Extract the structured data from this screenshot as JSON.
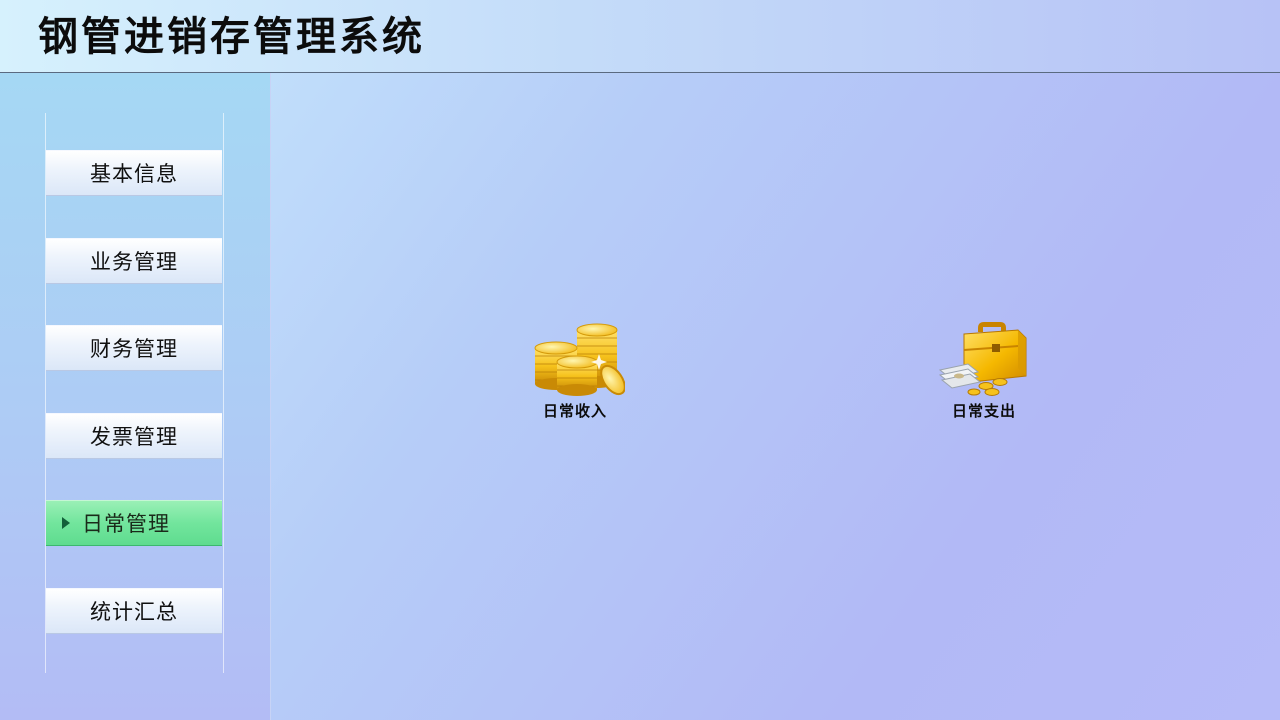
{
  "app": {
    "title": "钢管进销存管理系统"
  },
  "sidebar": {
    "items": [
      {
        "label": "基本信息"
      },
      {
        "label": "业务管理"
      },
      {
        "label": "财务管理"
      },
      {
        "label": "发票管理"
      },
      {
        "label": "日常管理",
        "selected": true
      },
      {
        "label": "统计汇总"
      }
    ]
  },
  "main": {
    "tiles": [
      {
        "label": "日常收入",
        "icon": "gold-coins-icon"
      },
      {
        "label": "日常支出",
        "icon": "briefcase-money-icon"
      }
    ]
  },
  "colors": {
    "active_item": "#72e59d",
    "active_arrow": "#13603a",
    "coin_gold": "#f6c21c",
    "briefcase_gold": "#f5b800"
  }
}
